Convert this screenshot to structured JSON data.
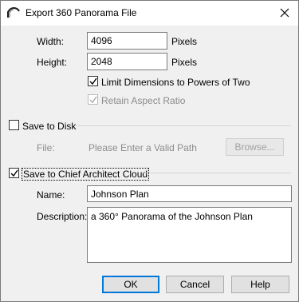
{
  "window": {
    "title": "Export 360 Panorama File"
  },
  "dimensions": {
    "width_label": "Width:",
    "width_value": "4096",
    "width_unit": "Pixels",
    "height_label": "Height:",
    "height_value": "2048",
    "height_unit": "Pixels",
    "limit_powers_label": "Limit Dimensions to Powers of Two",
    "limit_powers_checked": true,
    "aspect_label": "Retain Aspect Ratio",
    "aspect_checked": true
  },
  "save_disk": {
    "label": "Save to Disk",
    "checked": false,
    "file_label": "File:",
    "file_placeholder": "Please Enter a Valid Path",
    "browse_label": "Browse..."
  },
  "cloud": {
    "label": "Save to Chief Architect Cloud",
    "checked": true,
    "name_label": "Name:",
    "name_value": "Johnson Plan",
    "description_label": "Description:",
    "description_value": "a 360° Panorama of the Johnson Plan"
  },
  "buttons": {
    "ok": "OK",
    "cancel": "Cancel",
    "help": "Help"
  },
  "colors": {
    "accent": "#0078d7",
    "dialog_bg": "#f0f0f0",
    "disabled_text": "#8c8c8c"
  },
  "icons": {
    "app": "chief-architect-logo-icon",
    "close": "close-icon",
    "check": "check-icon"
  }
}
